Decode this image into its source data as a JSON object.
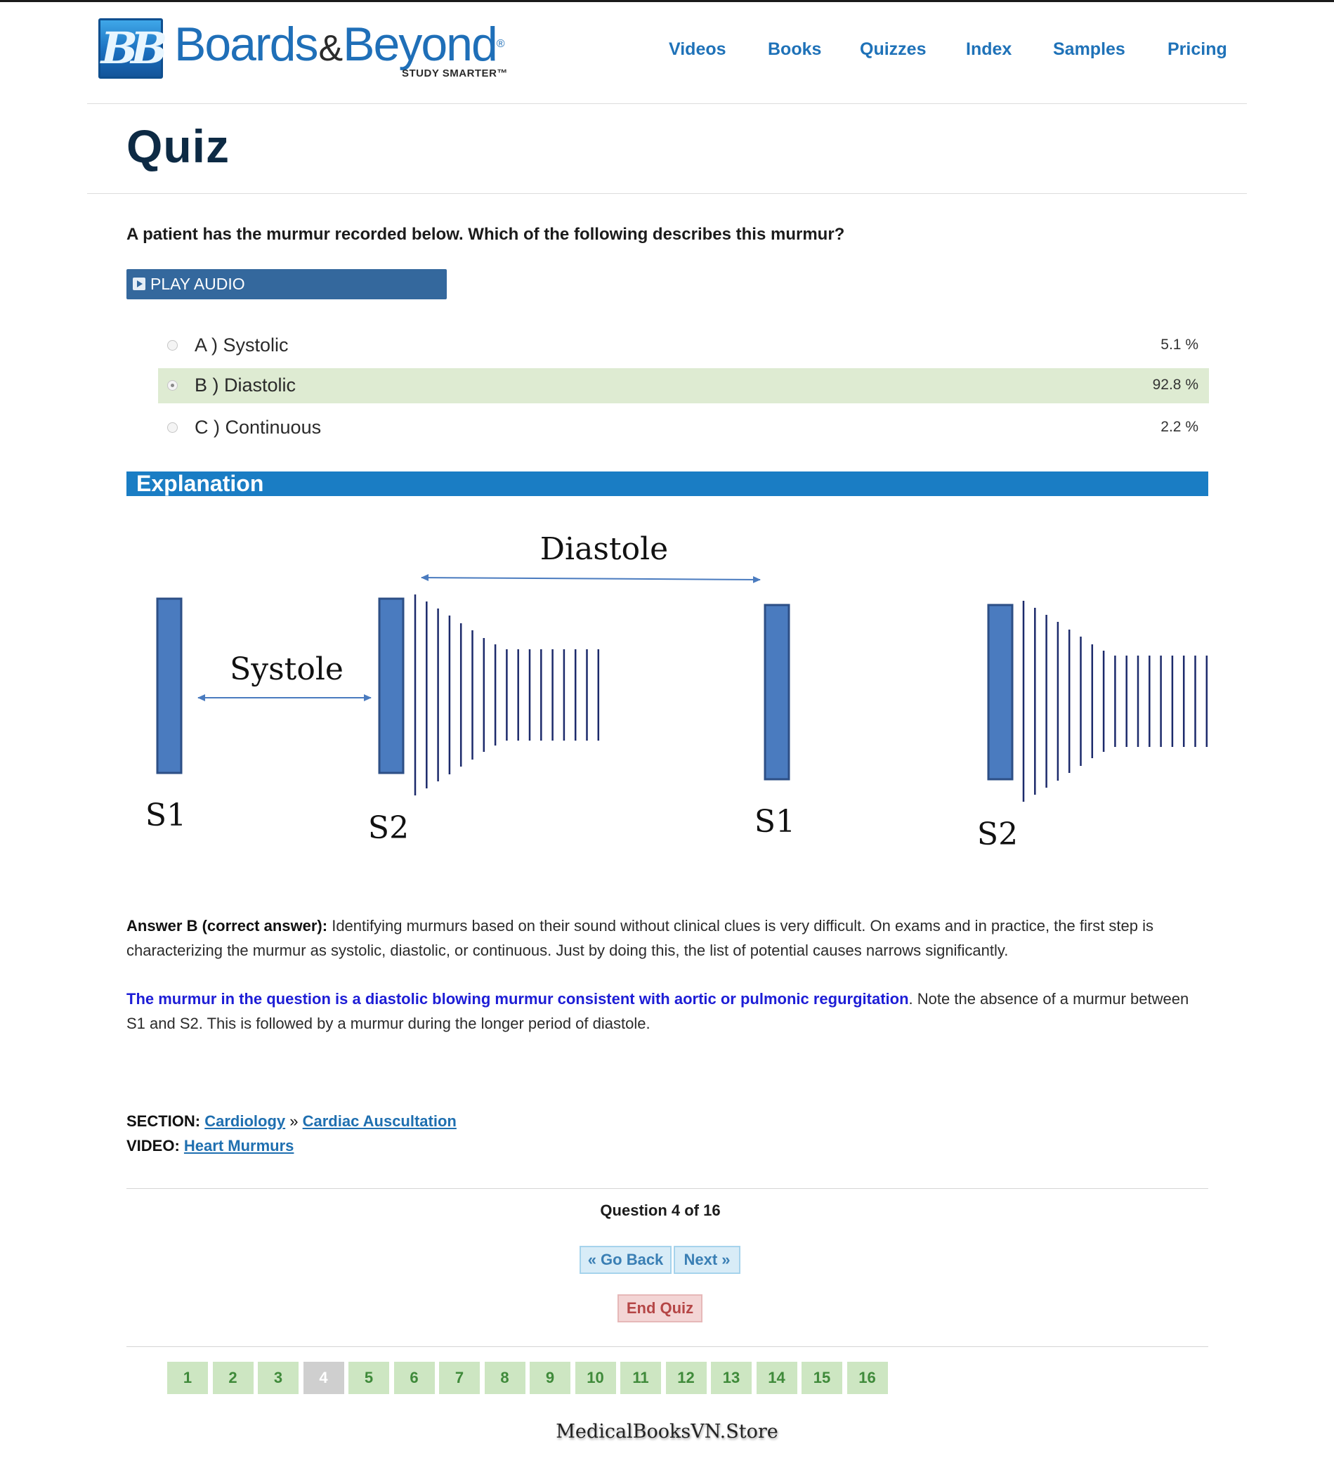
{
  "brand": {
    "mark": "BB",
    "name_part1": "Boards",
    "amp": "&",
    "name_part2": "Beyond",
    "registered": "®",
    "tagline": "STUDY SMARTER™"
  },
  "nav": {
    "items": [
      "Videos",
      "Books",
      "Quizzes",
      "Index",
      "Samples",
      "Pricing"
    ]
  },
  "page_title": "Quiz",
  "question": {
    "text": "A patient has the murmur recorded below. Which of the following describes this murmur?",
    "play_label": "PLAY AUDIO",
    "options": [
      {
        "label": "A ) Systolic",
        "percent": "5.1 %",
        "selected": false
      },
      {
        "label": "B ) Diastolic",
        "percent": "92.8 %",
        "selected": true
      },
      {
        "label": "C ) Continuous",
        "percent": "2.2 %",
        "selected": false
      }
    ]
  },
  "explanation": {
    "heading": "Explanation",
    "diagram": {
      "diastole_label": "Diastole",
      "systole_label": "Systole",
      "sound_labels": [
        "S1",
        "S2",
        "S1",
        "S2"
      ]
    },
    "answer_lead": "Answer B (correct answer):",
    "answer_text": " Identifying murmurs based on their sound without clinical clues is very difficult. On exams and in practice, the first step is characterizing the murmur as systolic, diastolic, or continuous. Just by doing this, the list of potential causes narrows significantly.",
    "highlight": "The murmur in the question is a diastolic blowing murmur consistent with aortic or pulmonic regurgitation",
    "followup": ". Note the absence of a murmur between S1 and S2. This is followed by a murmur during the longer period of diastole."
  },
  "meta": {
    "section_label": "SECTION:",
    "section_link1": "Cardiology",
    "section_sep": " » ",
    "section_link2": "Cardiac Auscultation",
    "video_label": "VIDEO:",
    "video_link": "Heart Murmurs"
  },
  "pager": {
    "counter": "Question 4 of 16",
    "back_label": "« Go Back",
    "next_label": "Next »",
    "end_label": "End Quiz",
    "pages": [
      "1",
      "2",
      "3",
      "4",
      "5",
      "6",
      "7",
      "8",
      "9",
      "10",
      "11",
      "12",
      "13",
      "14",
      "15",
      "16"
    ],
    "current": "4"
  },
  "watermark": "MedicalBooksVN.Store",
  "colors": {
    "brand_blue": "#1f72b8",
    "explanation_bar": "#1a7dc4",
    "selected_option": "#deebd2",
    "diagram_bar": "#4a7bbf",
    "diagram_lines": "#1c2a6b"
  }
}
